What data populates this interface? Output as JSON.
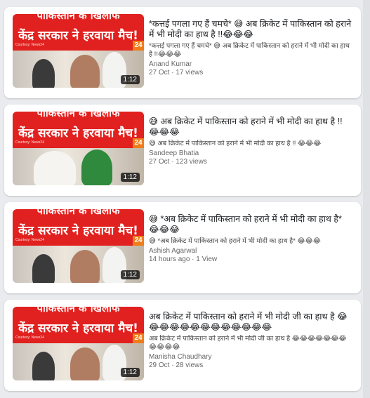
{
  "thumbnail_banner": {
    "line1": "पाकिस्तान के खिलाफ",
    "line2": "केंद्र सरकार ने हरवाया मैच!",
    "courtesy": "Courtesy: News24",
    "logo": "24"
  },
  "videos": [
    {
      "duration": "1:12",
      "title": "*कत्तई पगला गए हैं चमचे* 😅 अब क्रिकेट में पाकिस्तान को हराने में भी मोदी का हाथ है !!😂😂😂",
      "description": "*कत्तई पगला गए हैं चमचे* 😅 अब क्रिकेट में पाकिस्तान को हराने में भी मोदी का हाथ है !!😂😂😂",
      "channel": "Anand Kumar",
      "meta": "27 Oct · 17 views"
    },
    {
      "duration": "1:12",
      "title": "😅 अब क्रिकेट में पाकिस्तान को हराने में भी मोदी का हाथ है !! 😂😂😂",
      "description": "😅 अब क्रिकेट में पाकिस्तान को हराने में भी मोदी का हाथ है !! 😂😂😂",
      "channel": "Sandeep Bhatia",
      "meta": "27 Oct · 123 views"
    },
    {
      "duration": "1:12",
      "title": "😅 *अब क्रिकेट में पाकिस्तान को हराने में भी मोदी का हाथ है* 😂😂😂",
      "description": "😅 *अब क्रिकेट में पाकिस्तान को हराने में भी मोदी का हाथ है* 😂😂😂",
      "channel": "Ashish Agarwal",
      "meta": "14 hours ago · 1 View"
    },
    {
      "duration": "1:12",
      "title": "अब क्रिकेट में पाकिस्तान को हराने में भी मोदी जी का हाथ है 😂😂😂😂😂😂😂😂😂😂😂😂😂",
      "description": "अब क्रिकेट में पाकिस्तान को हराने में भी मोदी जी का हाथ है 😂😂😂😂😂😂😂😂😂😂😂",
      "channel": "Manisha Chaudhary",
      "meta": "29 Oct · 28 views"
    }
  ]
}
